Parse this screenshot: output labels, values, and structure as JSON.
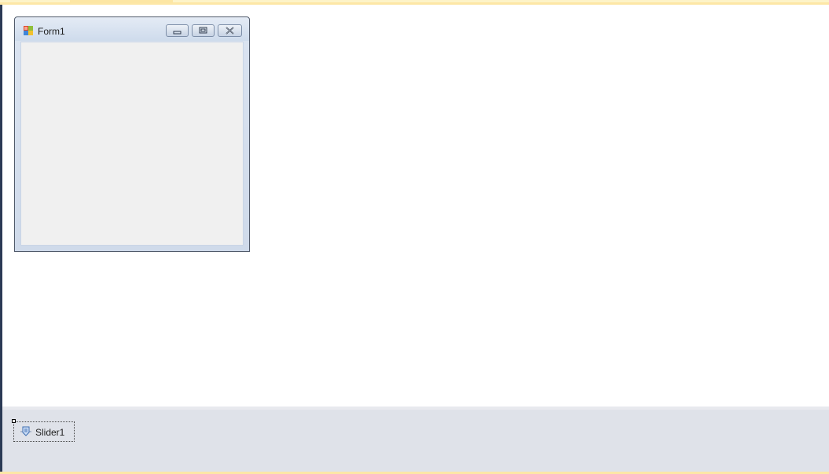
{
  "form": {
    "title": "Form1",
    "icon": "form-app-icon",
    "caption_buttons": [
      "minimize-icon",
      "maximize-icon",
      "close-icon"
    ]
  },
  "component_tray": {
    "items": [
      {
        "label": "Slider1",
        "icon": "slider-icon"
      }
    ]
  },
  "colors": {
    "frame": "#2b3a55",
    "top_strip": "#fdf3c8",
    "design_surface": "#ffffff",
    "tray_background": "#dfe2e9",
    "form_client": "#f0f0f0"
  }
}
